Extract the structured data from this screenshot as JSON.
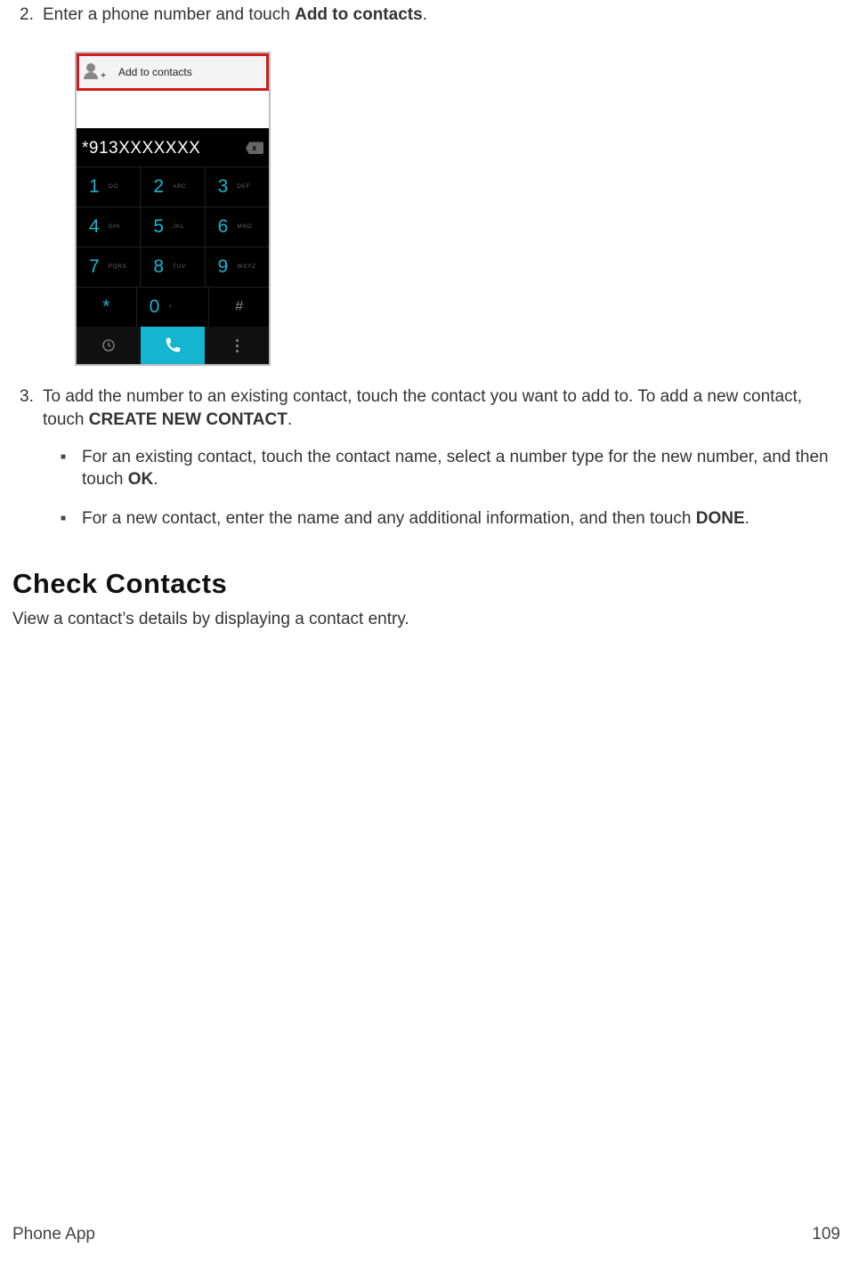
{
  "steps": {
    "s2": {
      "num": "2.",
      "text_a": "Enter a phone number and touch ",
      "bold": "Add to contacts",
      "text_b": "."
    },
    "s3": {
      "num": "3.",
      "text_a": "To add the number to an existing contact, touch the contact you want to add to. To add a new contact, touch ",
      "bold": "CREATE NEW CONTACT",
      "text_b": "."
    }
  },
  "sub": {
    "a": {
      "t1": "For an existing contact, touch the contact name, select a number type for the new number, and then touch ",
      "b": "OK",
      "t2": "."
    },
    "b": {
      "t1": "For a new contact, enter the name and any additional information, and then touch ",
      "b": "DONE",
      "t2": "."
    }
  },
  "screenshot": {
    "top_label": "Add to contacts",
    "number": "*913XXXXXXX",
    "keys": [
      [
        {
          "d": "1",
          "l": "OO"
        },
        {
          "d": "2",
          "l": "ABC"
        },
        {
          "d": "3",
          "l": "DEF"
        }
      ],
      [
        {
          "d": "4",
          "l": "GHI"
        },
        {
          "d": "5",
          "l": "JKL"
        },
        {
          "d": "6",
          "l": "MNO"
        }
      ],
      [
        {
          "d": "7",
          "l": "PQRS"
        },
        {
          "d": "8",
          "l": "TUV"
        },
        {
          "d": "9",
          "l": "WXYZ"
        }
      ],
      [
        {
          "d": "*",
          "l": ""
        },
        {
          "d": "0",
          "l": "+"
        },
        {
          "d": "#",
          "l": ""
        }
      ]
    ]
  },
  "section": {
    "heading": "Check Contacts",
    "desc": "View a contact’s details by displaying a contact entry."
  },
  "footer": {
    "left": "Phone App",
    "right": "109"
  }
}
